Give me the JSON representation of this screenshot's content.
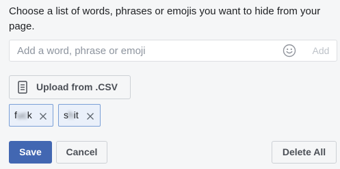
{
  "description": "Choose a list of words, phrases or emojis you want to hide from your page.",
  "input": {
    "placeholder": "Add a word, phrase or emoji",
    "value": "",
    "emoji_icon": "smiley-face-icon",
    "add_label": "Add"
  },
  "upload": {
    "icon": "document-icon",
    "label": "Upload from .CSV"
  },
  "tags": [
    {
      "prefix": "f",
      "hidden": "uc",
      "suffix": "k"
    },
    {
      "prefix": "s",
      "hidden": "h",
      "suffix": "it"
    }
  ],
  "actions": {
    "save_label": "Save",
    "cancel_label": "Cancel",
    "delete_all_label": "Delete All"
  },
  "colors": {
    "primary": "#4267b2",
    "tag_background": "#eaf0fa",
    "tag_border": "#7a9fd6",
    "page_background": "#f5f6f7"
  }
}
